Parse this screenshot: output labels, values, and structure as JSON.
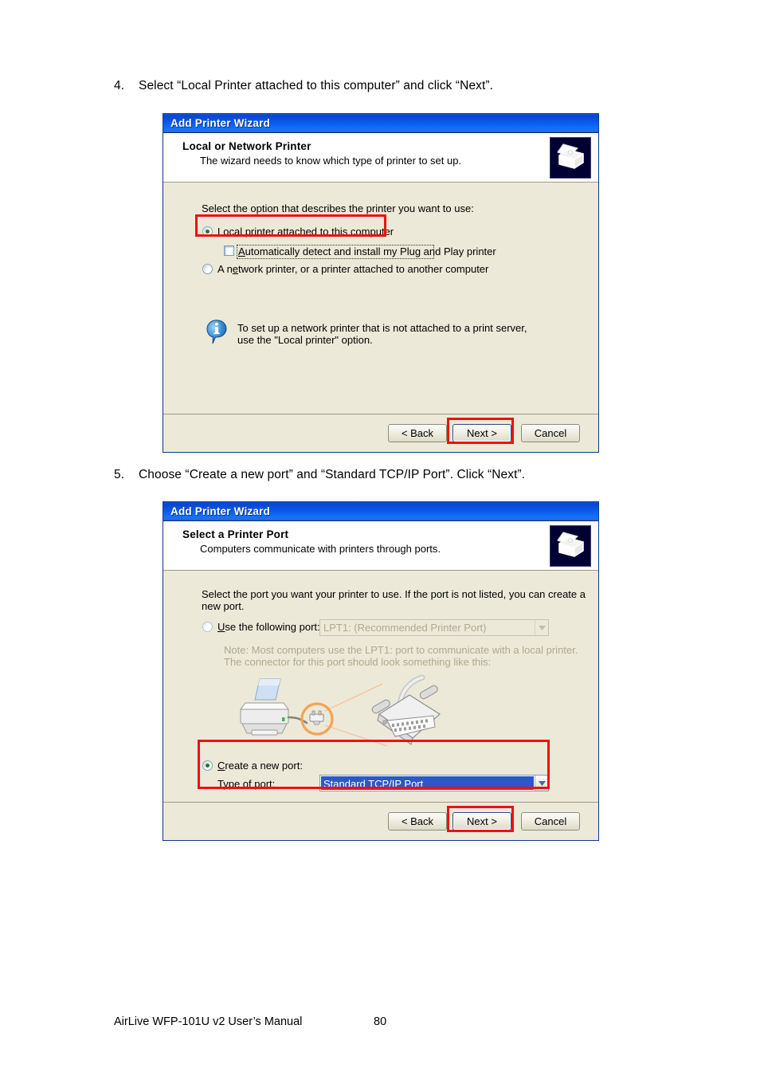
{
  "page": {
    "steps": [
      {
        "number": "4.",
        "text": "Select “Local Printer attached to this computer” and click “Next”."
      },
      {
        "number": "5.",
        "text": "Choose “Create a new port” and “Standard TCP/IP Port”. Click “Next”."
      }
    ],
    "footer": {
      "manual": "AirLive WFP-101U v2 User’s Manual",
      "page_number": "80"
    }
  },
  "colors": {
    "titlebar_blue": "#0A5CEA",
    "dialog_body": "#ECE9D8",
    "annotation_red": "#EE1111",
    "selection_blue": "#2B58C6",
    "radio_dot_green": "#1B7D1B",
    "icon_navy": "#000033",
    "highlight_orange": "#F0A050"
  },
  "dialog1": {
    "title": "Add Printer Wizard",
    "header": {
      "title": "Local or Network Printer",
      "subtitle": "The wizard needs to know which type of printer to set up.",
      "icon": "printer-icon"
    },
    "prompt": "Select the option that describes the printer you want to use:",
    "options": [
      {
        "label": "Local printer attached to this computer",
        "accel": "L",
        "checked": true
      },
      {
        "label": "A network printer, or a printer attached to another computer",
        "accel": "e",
        "checked": false
      }
    ],
    "checkbox": {
      "label": "Automatically detect and install my Plug and Play printer",
      "accel": "A",
      "checked": false
    },
    "info": {
      "icon": "info-icon",
      "line1": "To set up a network printer that is not attached to a print server,",
      "line2": "use the \"Local printer\" option."
    },
    "buttons": {
      "back": "< Back",
      "next": "Next >",
      "cancel": "Cancel"
    }
  },
  "dialog2": {
    "title": "Add Printer Wizard",
    "header": {
      "title": "Select a Printer Port",
      "subtitle": "Computers communicate with printers through ports.",
      "icon": "printer-icon"
    },
    "prompt_line1": "Select the port you want your printer to use.  If the port is not listed, you can create a",
    "prompt_line2": "new port.",
    "use_port": {
      "label": "Use the following port:",
      "accel": "U",
      "checked": false,
      "value": "LPT1: (Recommended Printer Port)",
      "disabled": true
    },
    "note_line1": "Note: Most computers use the LPT1: port to communicate with a local printer.",
    "note_line2": "The connector for this port should look something like this:",
    "illustration": "printer-parallel-connector-illustration",
    "create_port": {
      "label": "Create a new port:",
      "accel": "C",
      "checked": true,
      "type_label": "Type of port:",
      "type_value": "Standard TCP/IP Port"
    },
    "buttons": {
      "back": "< Back",
      "next": "Next >",
      "cancel": "Cancel"
    }
  }
}
